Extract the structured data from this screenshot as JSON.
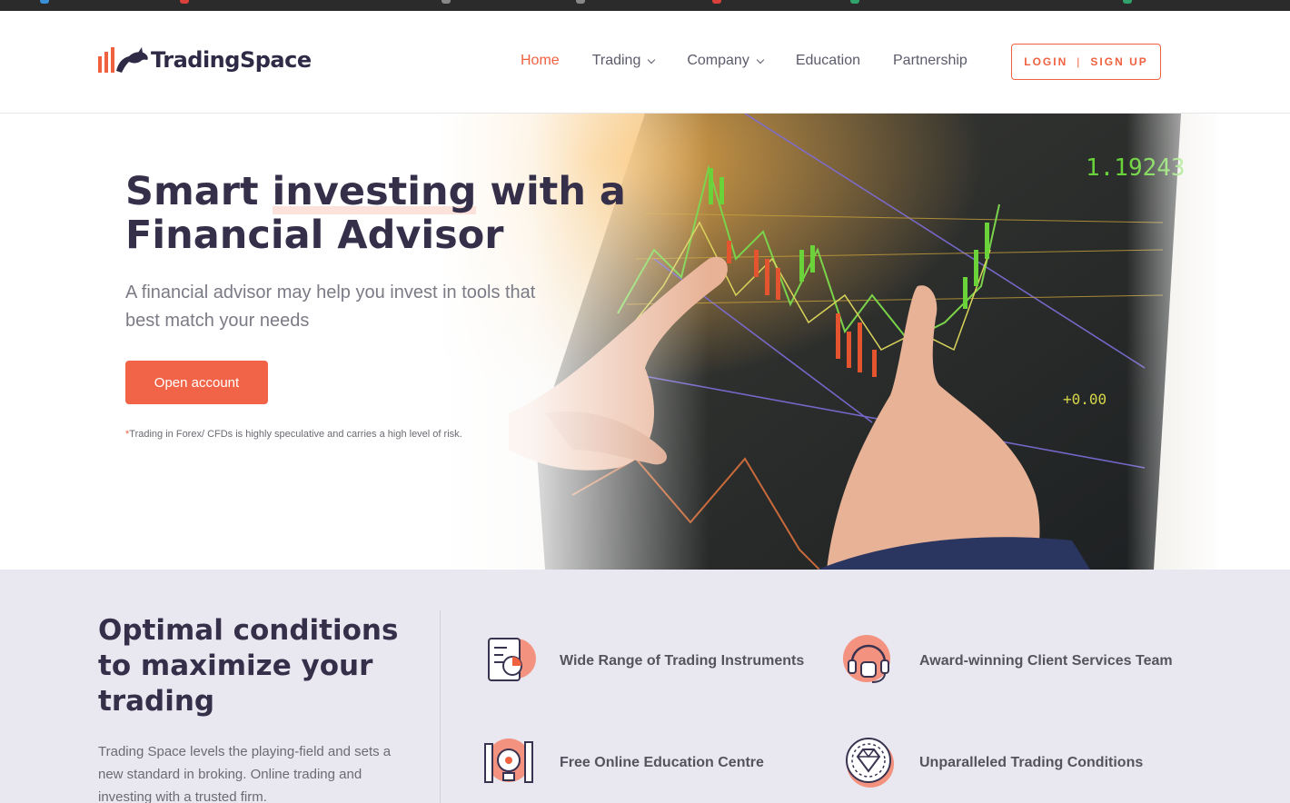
{
  "brand": {
    "name": "TradingSpace",
    "accent": "#f0613f",
    "dark": "#352f4a"
  },
  "nav": {
    "items": [
      {
        "label": "Home",
        "active": true,
        "dropdown": false
      },
      {
        "label": "Trading",
        "active": false,
        "dropdown": true
      },
      {
        "label": "Company",
        "active": false,
        "dropdown": true
      },
      {
        "label": "Education",
        "active": false,
        "dropdown": false
      },
      {
        "label": "Partnership",
        "active": false,
        "dropdown": false
      }
    ],
    "login": "LOGIN",
    "separator": "|",
    "signup": "SIGN UP"
  },
  "hero": {
    "title_part1": "Smart ",
    "title_highlight": "investing",
    "title_part2": " with a Financial Advisor",
    "subtitle": "A financial advisor may help you invest in tools that best match your needs",
    "cta": "Open account",
    "disclaimer_mark": "*",
    "disclaimer": "Trading in Forex/ CFDs is highly speculative and carries a high level of risk.",
    "image_icon": "trading-screen-photo"
  },
  "features": {
    "title": "Optimal conditions to maximize your trading",
    "text": "Trading Space levels the playing-field and sets a new standard in broking. Online trading and investing with a trusted firm.",
    "items": [
      {
        "label": "Wide Range of Trading Instruments",
        "icon": "report-chart-icon"
      },
      {
        "label": "Award-winning Client Services Team",
        "icon": "headset-icon"
      },
      {
        "label": "Free Online Education Centre",
        "icon": "education-tools-icon"
      },
      {
        "label": "Unparalleled Trading Conditions",
        "icon": "diamond-badge-icon"
      }
    ]
  }
}
